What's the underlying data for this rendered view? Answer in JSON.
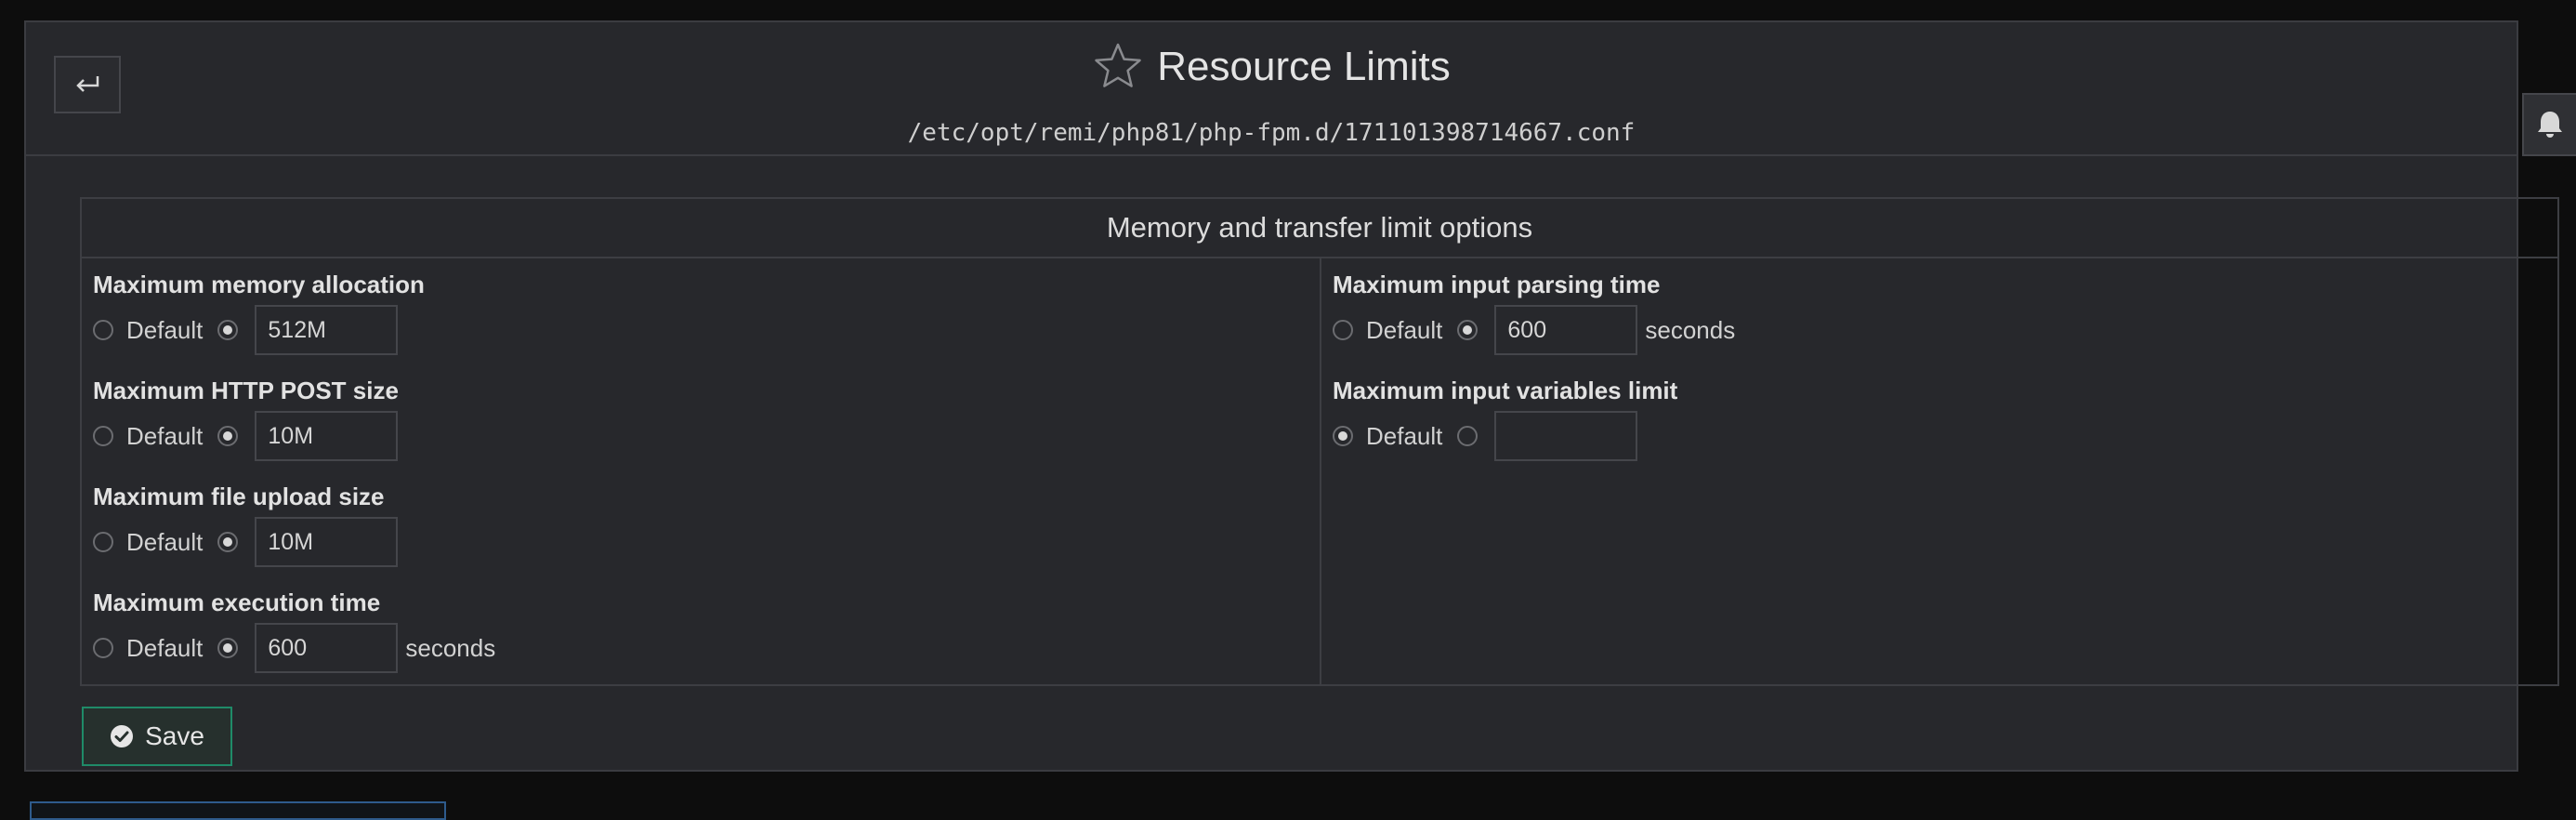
{
  "header": {
    "title": "Resource Limits",
    "config_path": "/etc/opt/remi/php81/php-fpm.d/171101398714667.conf",
    "back_icon": "return-arrow-icon",
    "title_icon": "star-icon",
    "notify_icon": "bell-icon"
  },
  "section": {
    "heading": "Memory and transfer limit options"
  },
  "labels": {
    "default": "Default",
    "seconds": "seconds"
  },
  "fields": {
    "memory_limit": {
      "label": "Maximum memory allocation",
      "selected": "custom",
      "value": "512M"
    },
    "post_max_size": {
      "label": "Maximum HTTP POST size",
      "selected": "custom",
      "value": "10M"
    },
    "upload_max_filesize": {
      "label": "Maximum file upload size",
      "selected": "custom",
      "value": "10M"
    },
    "max_execution_time": {
      "label": "Maximum execution time",
      "selected": "custom",
      "value": "600",
      "unit": "seconds"
    },
    "max_input_time": {
      "label": "Maximum input parsing time",
      "selected": "custom",
      "value": "600",
      "unit": "seconds"
    },
    "max_input_vars": {
      "label": "Maximum input variables limit",
      "selected": "default",
      "value": ""
    }
  },
  "actions": {
    "save_label": "Save",
    "save_icon": "check-circle-icon"
  },
  "colors": {
    "page_bg": "#0d0d0d",
    "panel_bg": "#27282c",
    "border": "#3b3c41",
    "save_border": "#1f8a68",
    "text": "#d6d6d6"
  }
}
